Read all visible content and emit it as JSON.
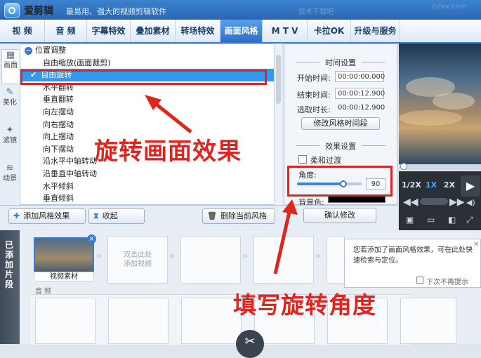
{
  "app": {
    "title": "爱剪辑",
    "slogan": "最易用、强大的视频剪辑软件",
    "watermark_1": "技术下载吧",
    "watermark_2": "itdxx.com"
  },
  "tabs": [
    {
      "label": "视  频"
    },
    {
      "label": "音  频"
    },
    {
      "label": "字幕特效"
    },
    {
      "label": "叠加素材"
    },
    {
      "label": "转场特效"
    },
    {
      "label": "画面风格",
      "active": true
    },
    {
      "label": "M T V"
    },
    {
      "label": "卡拉OK"
    },
    {
      "label": "升级与服务"
    }
  ],
  "side_tabs": [
    {
      "label": "画面",
      "active": true
    },
    {
      "label": "美化"
    },
    {
      "label": "滤镜"
    },
    {
      "label": "动景"
    }
  ],
  "tree": {
    "group": "位置调整",
    "items": [
      {
        "label": "自由缩放(画面裁剪)"
      },
      {
        "label": "自由旋转",
        "selected": true
      },
      {
        "label": "水平翻转"
      },
      {
        "label": "垂直翻转"
      },
      {
        "label": "向左摆动"
      },
      {
        "label": "向右摆动"
      },
      {
        "label": "向上摆动"
      },
      {
        "label": "向下摆动"
      },
      {
        "label": "沿水平中轴转动"
      },
      {
        "label": "沿垂直中轴转动"
      },
      {
        "label": "水平倾斜"
      },
      {
        "label": "垂直倾斜"
      }
    ]
  },
  "time_settings": {
    "heading": "时间设置",
    "start_label": "开始时间:",
    "start_value": "00:00:00.000",
    "end_label": "结束时间:",
    "end_value": "00:00:12.900",
    "duration_label": "选取时长:",
    "duration_value": "00:00:12.900",
    "modify_button": "修改风格时间段"
  },
  "effect_settings": {
    "heading": "效果设置",
    "soft_transition": "柔和过渡",
    "soft_transition_checked": false,
    "angle_label": "角度:",
    "angle_value": "90",
    "angle_fraction": 0.72,
    "background_label": "背景色:",
    "background_color": "#000000",
    "confirm_button": "确认修改"
  },
  "player": {
    "speeds": [
      "1/2X",
      "1X",
      "2X"
    ],
    "active_speed": "1X",
    "progress": 0.02
  },
  "actions": {
    "add": "添加风格效果",
    "collapse": "收起",
    "delete": "删除当前风格"
  },
  "timeline": {
    "side_label": "已添加片段",
    "clip_label": "视频素材",
    "empty_slot_line1": "双击此处",
    "empty_slot_line2": "添加视频",
    "audio_label": "音  频"
  },
  "tooltip": {
    "text": "您若添加了画面风格效果，可在此处快速检索与定位。",
    "checkbox_label": "下次不再提示"
  },
  "annotations": {
    "rotate_effect": "旋转画面效果",
    "fill_angle": "填写旋转角度",
    "color": "#e3231d"
  },
  "colors": {
    "accent": "#3b7bd0",
    "selection": "#3399ee",
    "title_bar": "#2a66b2"
  }
}
